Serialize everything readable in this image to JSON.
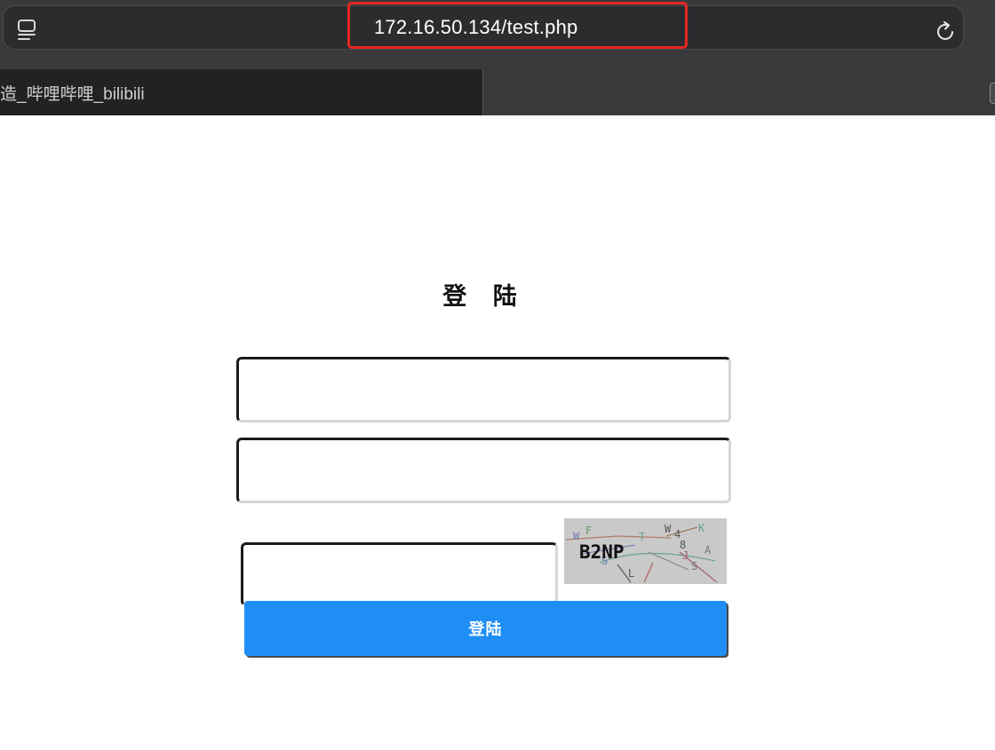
{
  "browser": {
    "url": "172.16.50.134/test.php",
    "tab": {
      "title": "造_哔哩哔哩_bilibili"
    },
    "icons": {
      "sidebar": "sidebar-icon",
      "reload": "reload-icon"
    },
    "highlight_color": "#e4271f"
  },
  "page": {
    "title": "登 陆",
    "username": {
      "value": "",
      "placeholder": ""
    },
    "password": {
      "value": "",
      "placeholder": ""
    },
    "captcha_input": {
      "value": "",
      "placeholder": ""
    },
    "captcha_image": {
      "text": "B2NP"
    },
    "login_button_label": "登陆",
    "accent_color": "#1e8ef5"
  }
}
